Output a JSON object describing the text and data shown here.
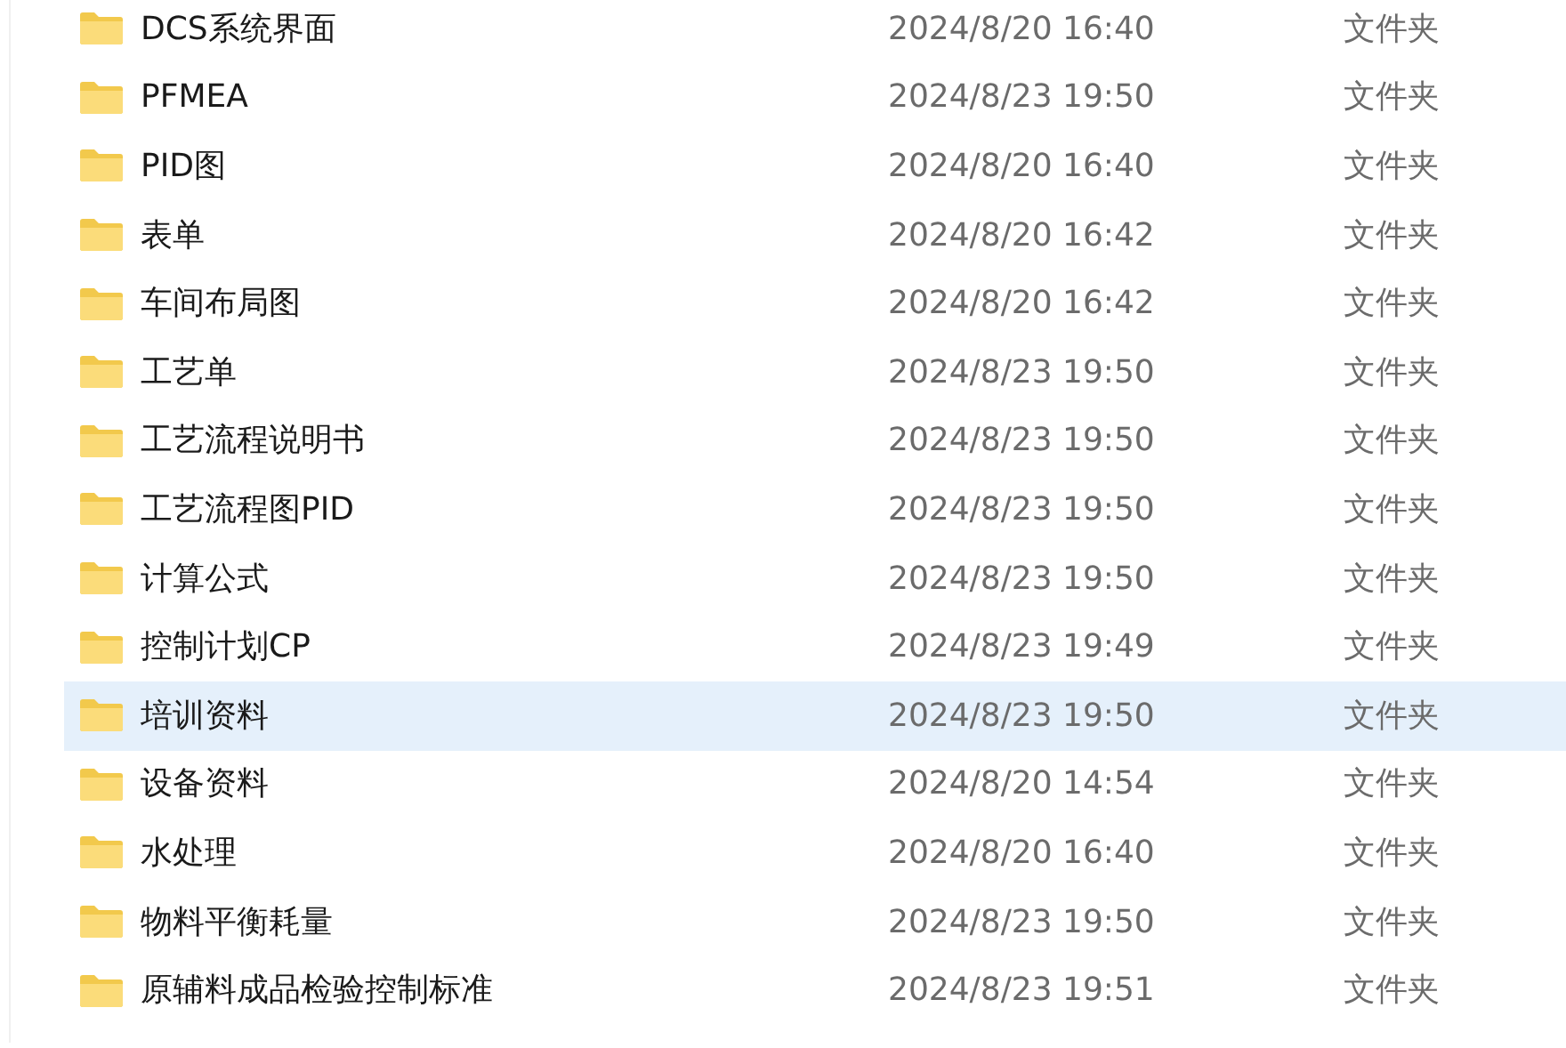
{
  "files": [
    {
      "name": "DCS系统界面",
      "modified": "2024/8/20 16:40",
      "type": "文件夹",
      "selected": false
    },
    {
      "name": "PFMEA",
      "modified": "2024/8/23 19:50",
      "type": "文件夹",
      "selected": false
    },
    {
      "name": "PID图",
      "modified": "2024/8/20 16:40",
      "type": "文件夹",
      "selected": false
    },
    {
      "name": "表单",
      "modified": "2024/8/20 16:42",
      "type": "文件夹",
      "selected": false
    },
    {
      "name": "车间布局图",
      "modified": "2024/8/20 16:42",
      "type": "文件夹",
      "selected": false
    },
    {
      "name": "工艺单",
      "modified": "2024/8/23 19:50",
      "type": "文件夹",
      "selected": false
    },
    {
      "name": "工艺流程说明书",
      "modified": "2024/8/23 19:50",
      "type": "文件夹",
      "selected": false
    },
    {
      "name": "工艺流程图PID",
      "modified": "2024/8/23 19:50",
      "type": "文件夹",
      "selected": false
    },
    {
      "name": "计算公式",
      "modified": "2024/8/23 19:50",
      "type": "文件夹",
      "selected": false
    },
    {
      "name": "控制计划CP",
      "modified": "2024/8/23 19:49",
      "type": "文件夹",
      "selected": false
    },
    {
      "name": "培训资料",
      "modified": "2024/8/23 19:50",
      "type": "文件夹",
      "selected": true
    },
    {
      "name": "设备资料",
      "modified": "2024/8/20 14:54",
      "type": "文件夹",
      "selected": false
    },
    {
      "name": "水处理",
      "modified": "2024/8/20 16:40",
      "type": "文件夹",
      "selected": false
    },
    {
      "name": "物料平衡耗量",
      "modified": "2024/8/23 19:50",
      "type": "文件夹",
      "selected": false
    },
    {
      "name": "原辅料成品检验控制标准",
      "modified": "2024/8/23 19:51",
      "type": "文件夹",
      "selected": false
    }
  ]
}
